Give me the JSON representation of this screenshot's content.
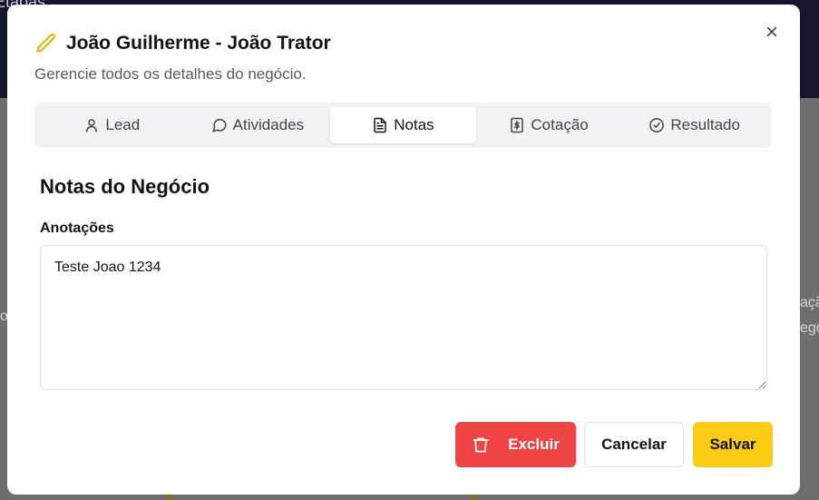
{
  "background": {
    "ghost_text": "Etapas",
    "right_fragments": [
      "ação",
      "egó"
    ],
    "left_fragment": "o"
  },
  "modal": {
    "title": "João Guilherme - João Trator",
    "subtitle": "Gerencie todos os detalhes do negócio.",
    "title_icon": "pencil-icon",
    "accent_color": "#facc15"
  },
  "tabs": [
    {
      "label": "Lead",
      "icon": "user-icon",
      "active": false
    },
    {
      "label": "Atividades",
      "icon": "message-circle-icon",
      "active": false
    },
    {
      "label": "Notas",
      "icon": "file-text-icon",
      "active": true
    },
    {
      "label": "Cotação",
      "icon": "dollar-sign-icon",
      "active": false
    },
    {
      "label": "Resultado",
      "icon": "check-circle-icon",
      "active": false
    }
  ],
  "notes": {
    "section_title": "Notas do Negócio",
    "field_label": "Anotações",
    "value": "Teste Joao 1234"
  },
  "actions": {
    "delete_label": "Excluir",
    "cancel_label": "Cancelar",
    "save_label": "Salvar",
    "delete_color": "#ef4444",
    "save_color": "#facc15"
  }
}
